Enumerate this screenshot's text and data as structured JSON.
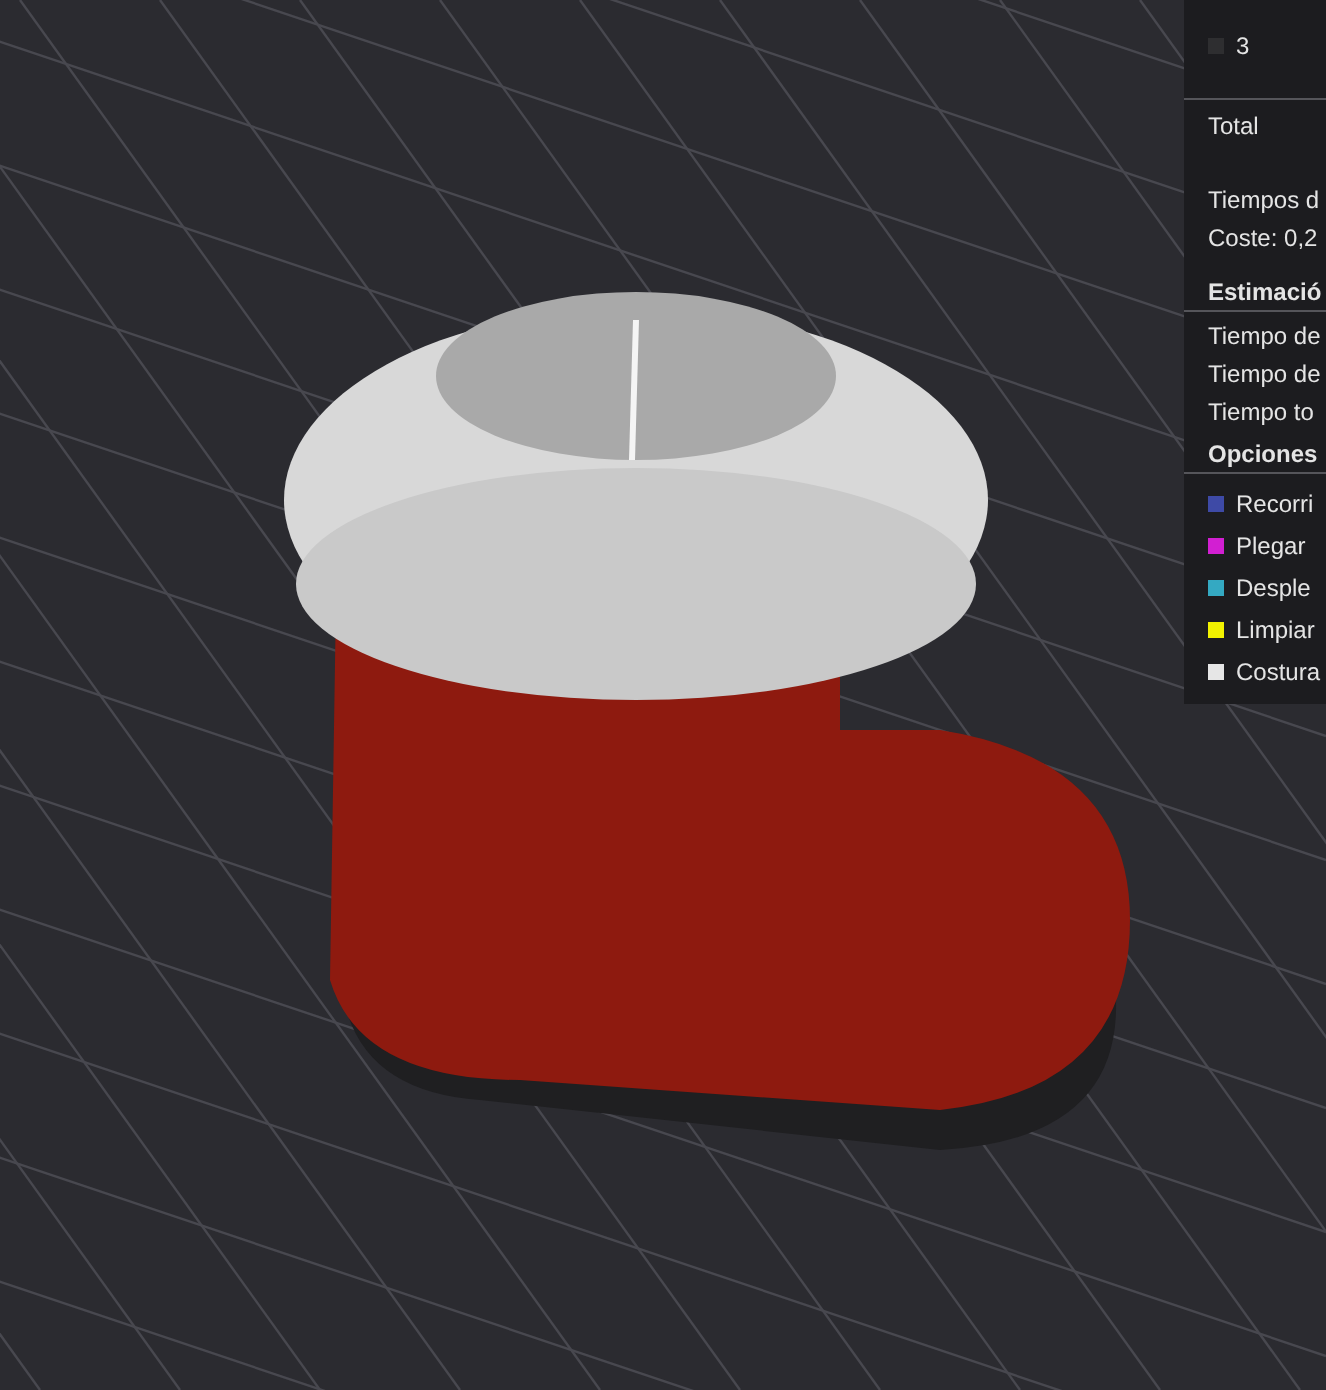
{
  "filament_list": {
    "items": [
      {
        "label": "3",
        "color": "#2e2e30"
      }
    ]
  },
  "total": {
    "label": "Total"
  },
  "summary": {
    "lines": [
      "Tiempos d",
      "Coste:  0,2"
    ]
  },
  "estimation": {
    "title": "Estimació",
    "lines": [
      "Tiempo de",
      "Tiempo de",
      "Tiempo to"
    ]
  },
  "options": {
    "title": "Opciones",
    "items": [
      {
        "label": "Recorri",
        "color": "#3e4aa6"
      },
      {
        "label": "Plegar",
        "color": "#d21fd2"
      },
      {
        "label": "Desple",
        "color": "#34a9c2"
      },
      {
        "label": "Limpiar",
        "color": "#f2f200"
      },
      {
        "label": "Costura",
        "color": "#e6e6e6"
      }
    ]
  }
}
